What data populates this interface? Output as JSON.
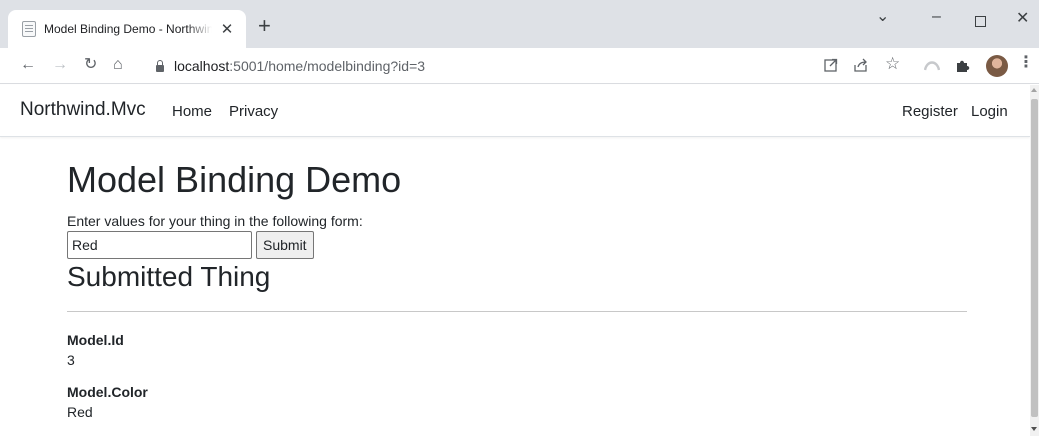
{
  "browser": {
    "tab_title": "Model Binding Demo - Northwind.Mvc",
    "tab_close": "✕",
    "new_tab": "+",
    "window_controls": {
      "dropdown": "⌄",
      "minimize": "–",
      "close": "✕"
    },
    "nav": {
      "back": "←",
      "forward": "→",
      "reload": "↻",
      "home": "⌂"
    },
    "url_host": "localhost",
    "url_rest": ":5001/home/modelbinding?id=3",
    "toolbar_icons": [
      "open-in-new-icon",
      "share-icon",
      "bookmark-star-icon",
      "extension-icon",
      "puzzle-icon",
      "profile-avatar",
      "menu-icon"
    ]
  },
  "navbar": {
    "brand": "Northwind.Mvc",
    "links": [
      "Home",
      "Privacy"
    ],
    "right_links": [
      "Register",
      "Login"
    ]
  },
  "main": {
    "title": "Model Binding Demo",
    "intro": "Enter values for your thing in the following form:",
    "color_input_value": "Red",
    "submit_label": "Submit",
    "submitted_heading": "Submitted Thing",
    "fields": [
      {
        "label": "Model.Id",
        "value": "3"
      },
      {
        "label": "Model.Color",
        "value": "Red"
      }
    ]
  }
}
